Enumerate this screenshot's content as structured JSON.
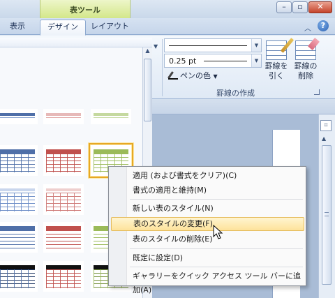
{
  "title_strip": {
    "context_group": "表ツール",
    "window_controls": [
      "minimize-icon",
      "restore-icon",
      "close-icon"
    ]
  },
  "tabs": [
    {
      "label": "表示",
      "active": false
    },
    {
      "label": "デザイン",
      "active": true
    },
    {
      "label": "レイアウト",
      "active": false
    }
  ],
  "ribbon": {
    "minimize_icon": "chevron-up-icon",
    "help_icon": "?",
    "pen_style_value": "",
    "pen_weight_value": "0.25 pt",
    "pen_color_label": "ペンの色",
    "draw_borders_label": [
      "罫線を",
      "引く"
    ],
    "erase_borders_label": [
      "罫線の",
      "削除"
    ],
    "group_label": "罫線の作成"
  },
  "gallery": {
    "row_colors": [
      "#4f6fa8",
      "#c0504d",
      "#9bbb59"
    ],
    "selected": {
      "row": 1,
      "col": 2
    }
  },
  "context_menu": {
    "items": [
      {
        "label": "適用 (および書式をクリア)(C)"
      },
      {
        "label": "書式の適用と維持(M)"
      },
      {
        "label": "新しい表のスタイル(N)"
      },
      {
        "label": "表のスタイルの変更(F)",
        "highlighted": true
      },
      {
        "label": "表のスタイルの削除(E)"
      },
      {
        "label": "既定に設定(D)"
      },
      {
        "label": "ギャラリーをクイック アクセス ツール バーに追加(A)"
      }
    ]
  },
  "colors": {
    "accent_blue": "#4f6fa8",
    "accent_red": "#c0504d",
    "accent_green": "#9bbb59",
    "highlight": "#fde29a"
  }
}
